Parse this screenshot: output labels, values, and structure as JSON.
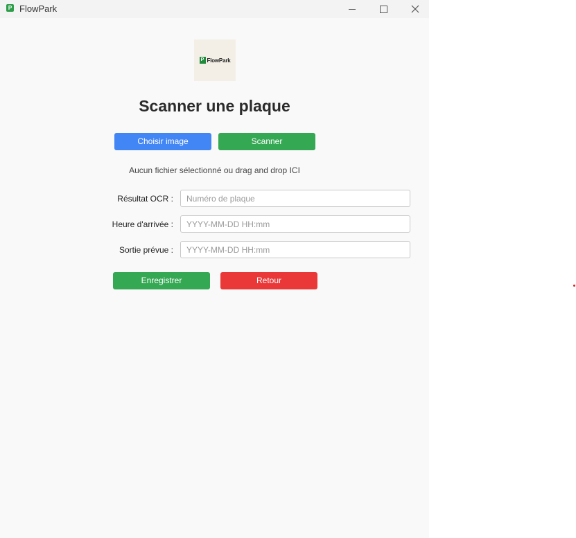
{
  "window": {
    "title": "FlowPark",
    "app_icon_glyph": "P"
  },
  "logo": {
    "mark": "P",
    "text": "FlowPark"
  },
  "page": {
    "heading": "Scanner une plaque"
  },
  "actions": {
    "choose_image_label": "Choisir image",
    "scan_label": "Scanner"
  },
  "file_status": "Aucun fichier sélectionné ou drag and drop ICI",
  "form": {
    "ocr": {
      "label": "Résultat OCR :",
      "placeholder": "Numéro de plaque",
      "value": ""
    },
    "arrival": {
      "label": "Heure d'arrivée :",
      "placeholder": "YYYY-MM-DD HH:mm",
      "value": ""
    },
    "exit": {
      "label": "Sortie prévue :",
      "placeholder": "YYYY-MM-DD HH:mm",
      "value": ""
    }
  },
  "footer": {
    "save_label": "Enregistrer",
    "back_label": "Retour"
  },
  "colors": {
    "primary_blue": "#4285f4",
    "green": "#34a853",
    "red": "#ea3838",
    "background": "#f9f9f9"
  },
  "icons": {
    "minimize": "minimize-icon",
    "maximize": "maximize-icon",
    "close": "close-icon"
  }
}
